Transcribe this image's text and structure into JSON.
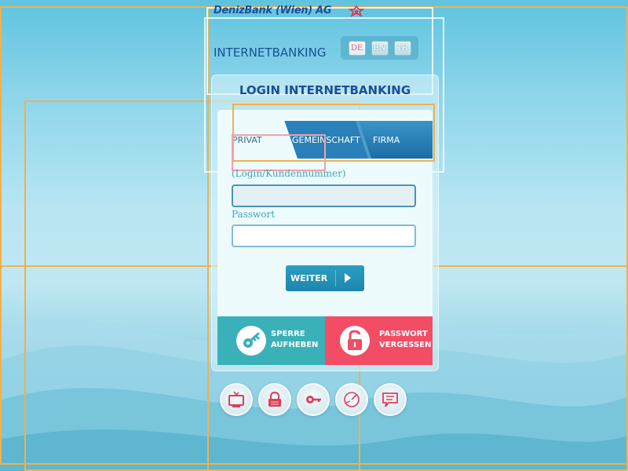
{
  "brand": {
    "name": "DenizBank (Wien) AG",
    "accent": "#e0304a",
    "color": "#1c4f95"
  },
  "header": {
    "title": "INTERNETBANKING"
  },
  "languages": [
    {
      "code": "DE",
      "active": true
    },
    {
      "code": "EN",
      "active": false
    },
    {
      "code": "TR",
      "active": false
    }
  ],
  "login": {
    "title": "LOGIN INTERNETBANKING",
    "tabs": [
      {
        "label": "PRIVAT",
        "active": true
      },
      {
        "label": "GEMEINSCHAFT",
        "active": false
      },
      {
        "label": "FIRMA",
        "active": false
      }
    ],
    "customer_label": "(Login/Kundennummer)",
    "customer_value": "",
    "password_label": "Passwort",
    "password_value": "",
    "submit_label": "WEITER"
  },
  "actions": {
    "unlock_line1": "SPERRE",
    "unlock_line2": "AUFHEBEN",
    "forgot_line1": "PASSWORT",
    "forgot_line2": "VERGESSEN",
    "unlock_color": "#3ab1b8",
    "forgot_color": "#f34d66"
  },
  "tools": [
    {
      "icon": "tv-icon"
    },
    {
      "icon": "lock-icon"
    },
    {
      "icon": "key-icon"
    },
    {
      "icon": "speedometer-icon"
    },
    {
      "icon": "chat-icon"
    }
  ]
}
